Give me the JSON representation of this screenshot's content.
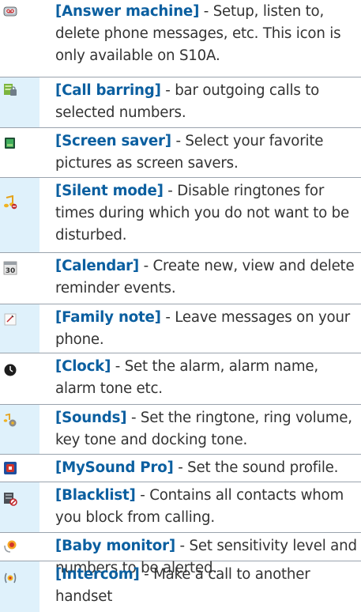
{
  "rows": [
    {
      "label": "[Answer machine]",
      "desc": " - Setup, listen to, delete phone messages, etc. This icon is only available on S10A.",
      "icon": "answer-machine-icon",
      "bg": "#ffffff"
    },
    {
      "label": "[Call barring]",
      "desc": " - bar outgoing calls to selected numbers.",
      "icon": "call-barring-icon",
      "bg": "#dff1fb"
    },
    {
      "label": "[Screen saver]",
      "desc": " - Select your favorite pictures as screen savers.",
      "icon": "screen-saver-icon",
      "bg": "#ffffff"
    },
    {
      "label": "[Silent mode]",
      "desc": " - Disable ringtones for times during which you do not want to be disturbed.",
      "icon": "silent-mode-icon",
      "bg": "#dff1fb"
    },
    {
      "label": "[Calendar]",
      "desc": " - Create new, view and delete reminder events.",
      "icon": "calendar-icon",
      "icon_text": "30",
      "bg": "#ffffff"
    },
    {
      "label": "[Family note]",
      "desc": " - Leave messages on your phone.",
      "icon": "family-note-icon",
      "bg": "#dff1fb"
    },
    {
      "label": "[Clock]",
      "desc": " - Set the alarm, alarm name, alarm tone etc.",
      "icon": "clock-icon",
      "bg": "#ffffff"
    },
    {
      "label": "[Sounds]",
      "desc": " - Set the ringtone, ring volume, key tone and docking tone.",
      "icon": "sounds-icon",
      "bg": "#dff1fb"
    },
    {
      "label": "[MySound Pro]",
      "desc": " - Set the sound profile.",
      "icon": "mysound-pro-icon",
      "bg": "#ffffff"
    },
    {
      "label": "[Blacklist]",
      "desc": " - Contains all contacts whom you block from calling.",
      "icon": "blacklist-icon",
      "bg": "#dff1fb"
    },
    {
      "label": "[Baby monitor]",
      "desc": " - Set sensitivity level and numbers to be alerted.",
      "icon": "baby-monitor-icon",
      "bg": "#ffffff"
    },
    {
      "label": "[Intercom]",
      "desc": " - Make a call to another handset",
      "icon": "intercom-icon",
      "bg": "#dff1fb"
    }
  ]
}
